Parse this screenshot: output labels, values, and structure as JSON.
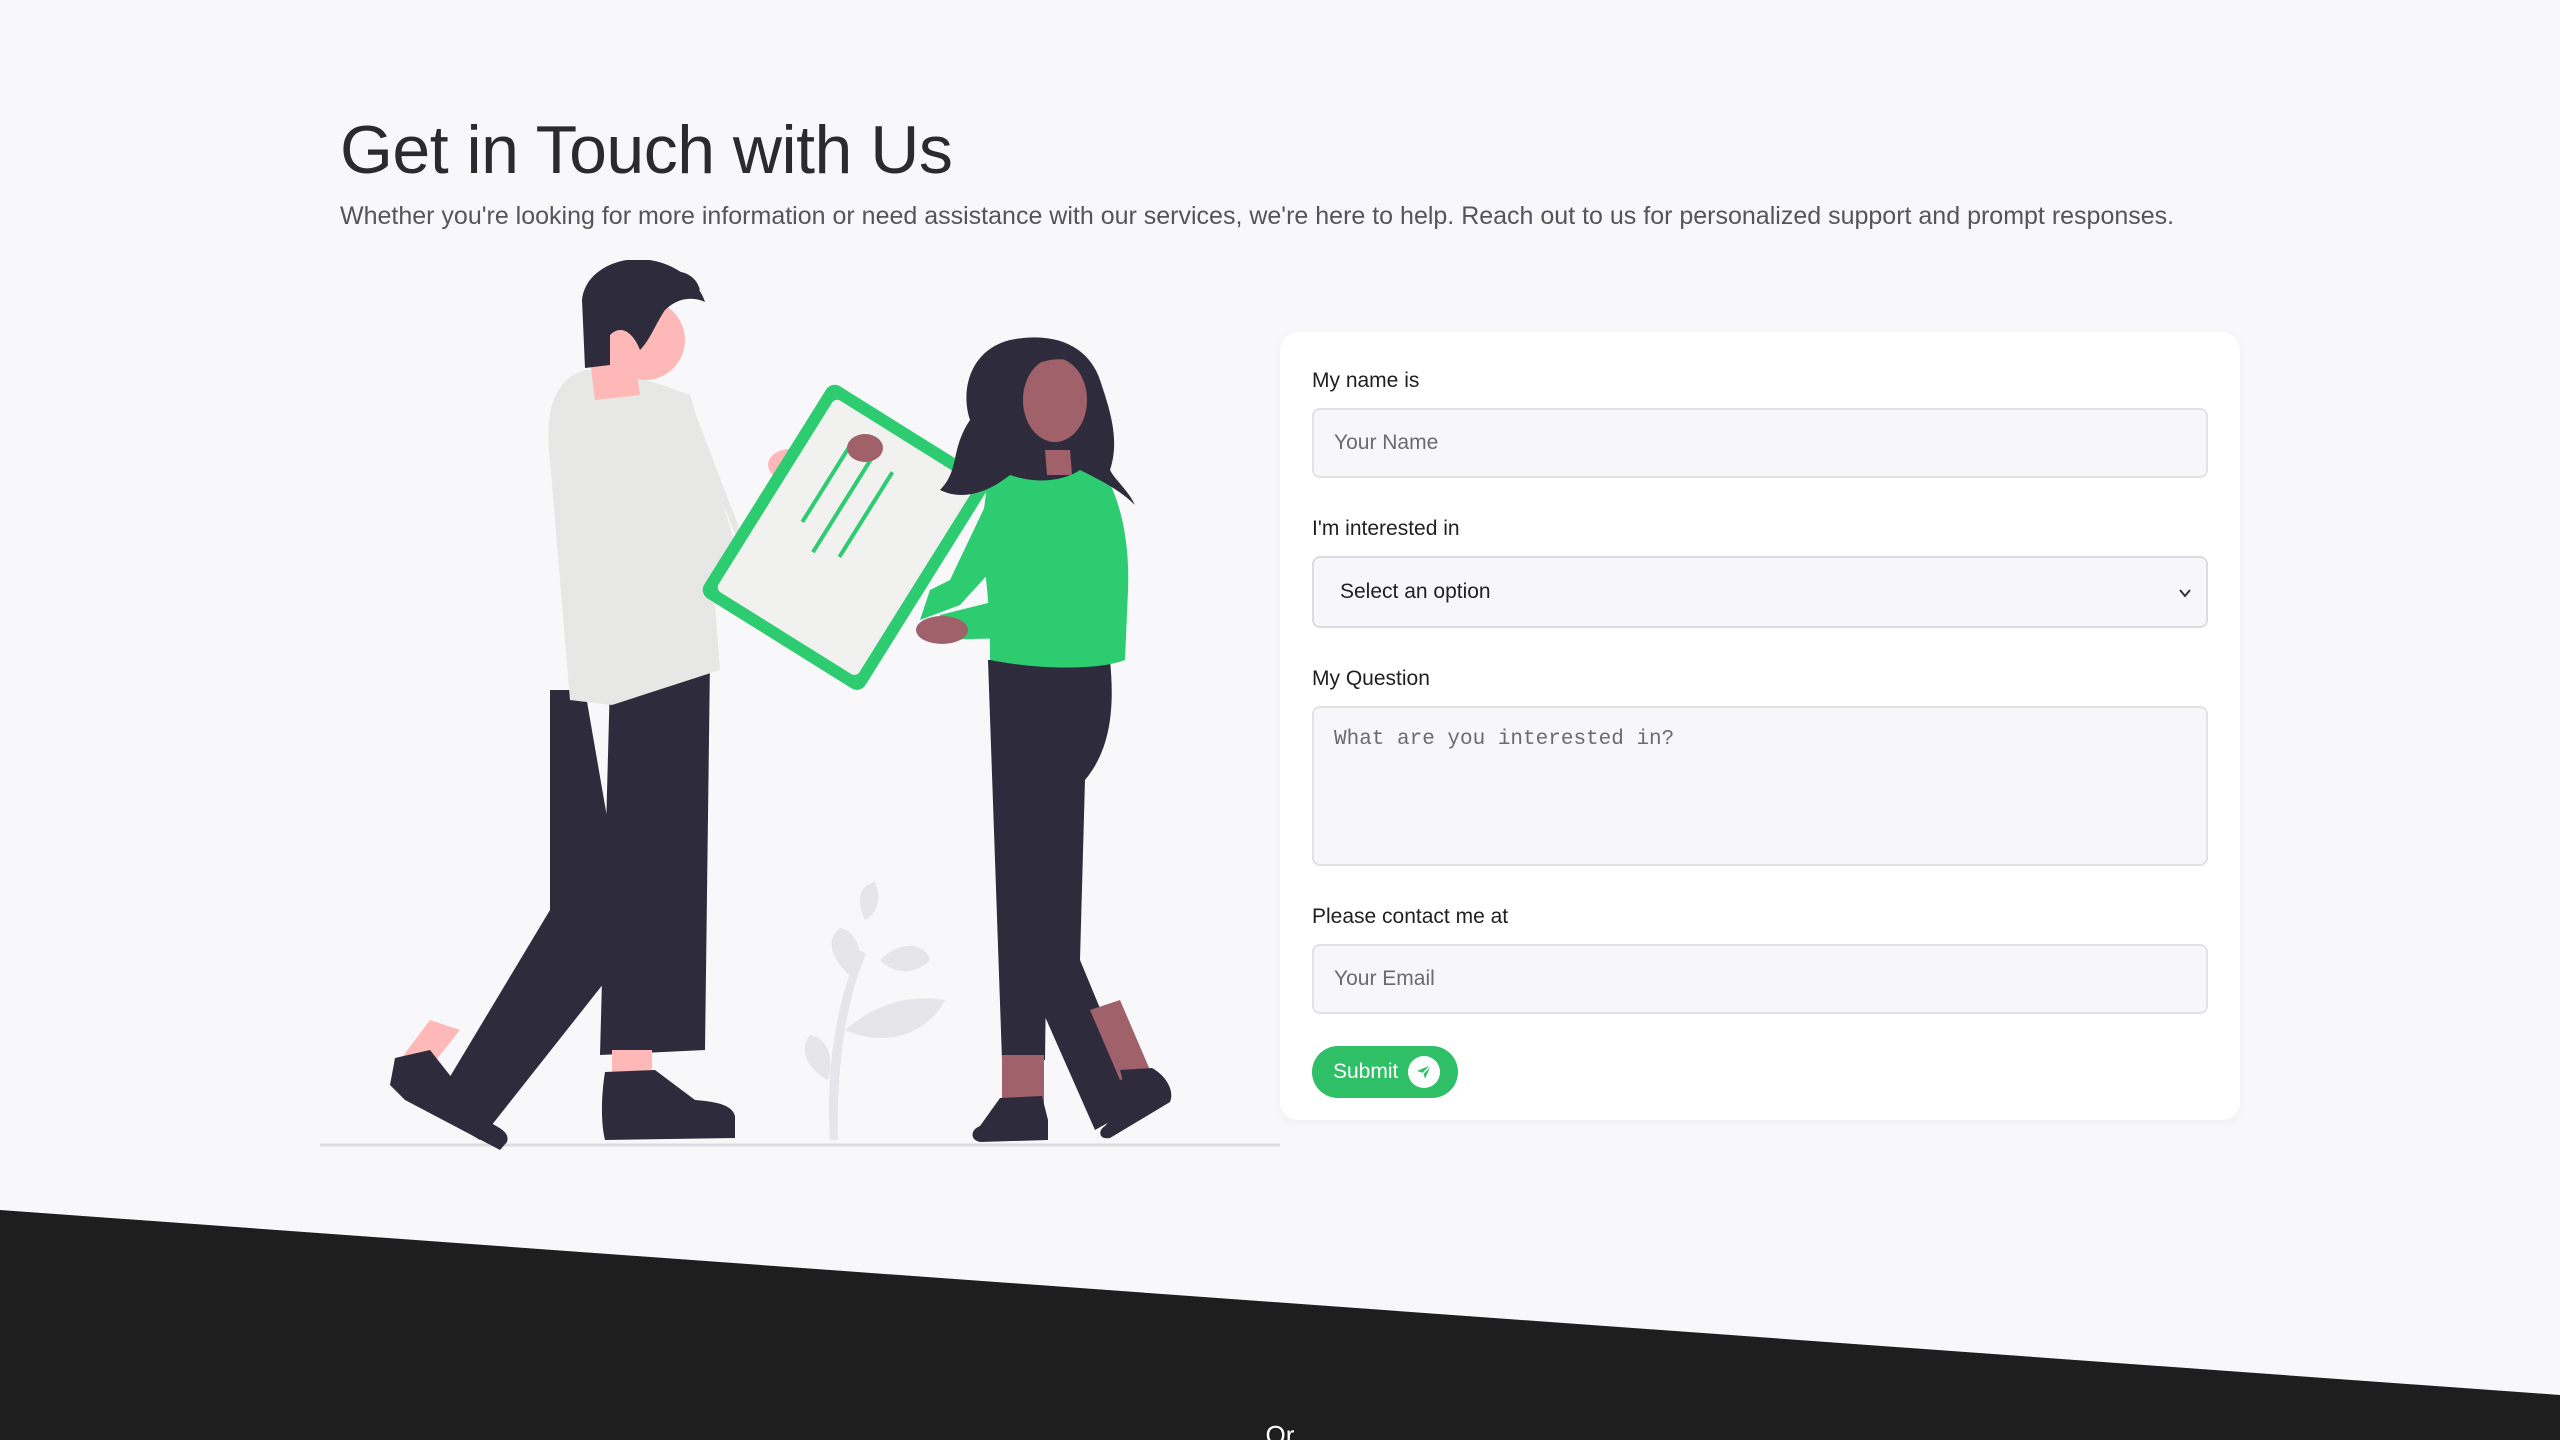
{
  "header": {
    "title": "Get in Touch with Us",
    "subtitle": "Whether you're looking for more information or need assistance with our services, we're here to help. Reach out to us for personalized support and prompt responses."
  },
  "form": {
    "name_label": "My name is",
    "name_placeholder": "Your Name",
    "interest_label": "I'm interested in",
    "interest_selected": "Select an option",
    "question_label": "My Question",
    "question_placeholder": "What are you interested in?",
    "contact_label": "Please contact me at",
    "email_placeholder": "Your Email",
    "submit_label": "Submit"
  },
  "footer": {
    "or_text": "Or"
  },
  "colors": {
    "accent": "#2fbf66",
    "illustration_green": "#2ecc71",
    "dark_band": "#1e1e1e",
    "page_background": "#f8f8fa"
  },
  "icons": [
    "chevron-down-icon",
    "send-icon"
  ]
}
